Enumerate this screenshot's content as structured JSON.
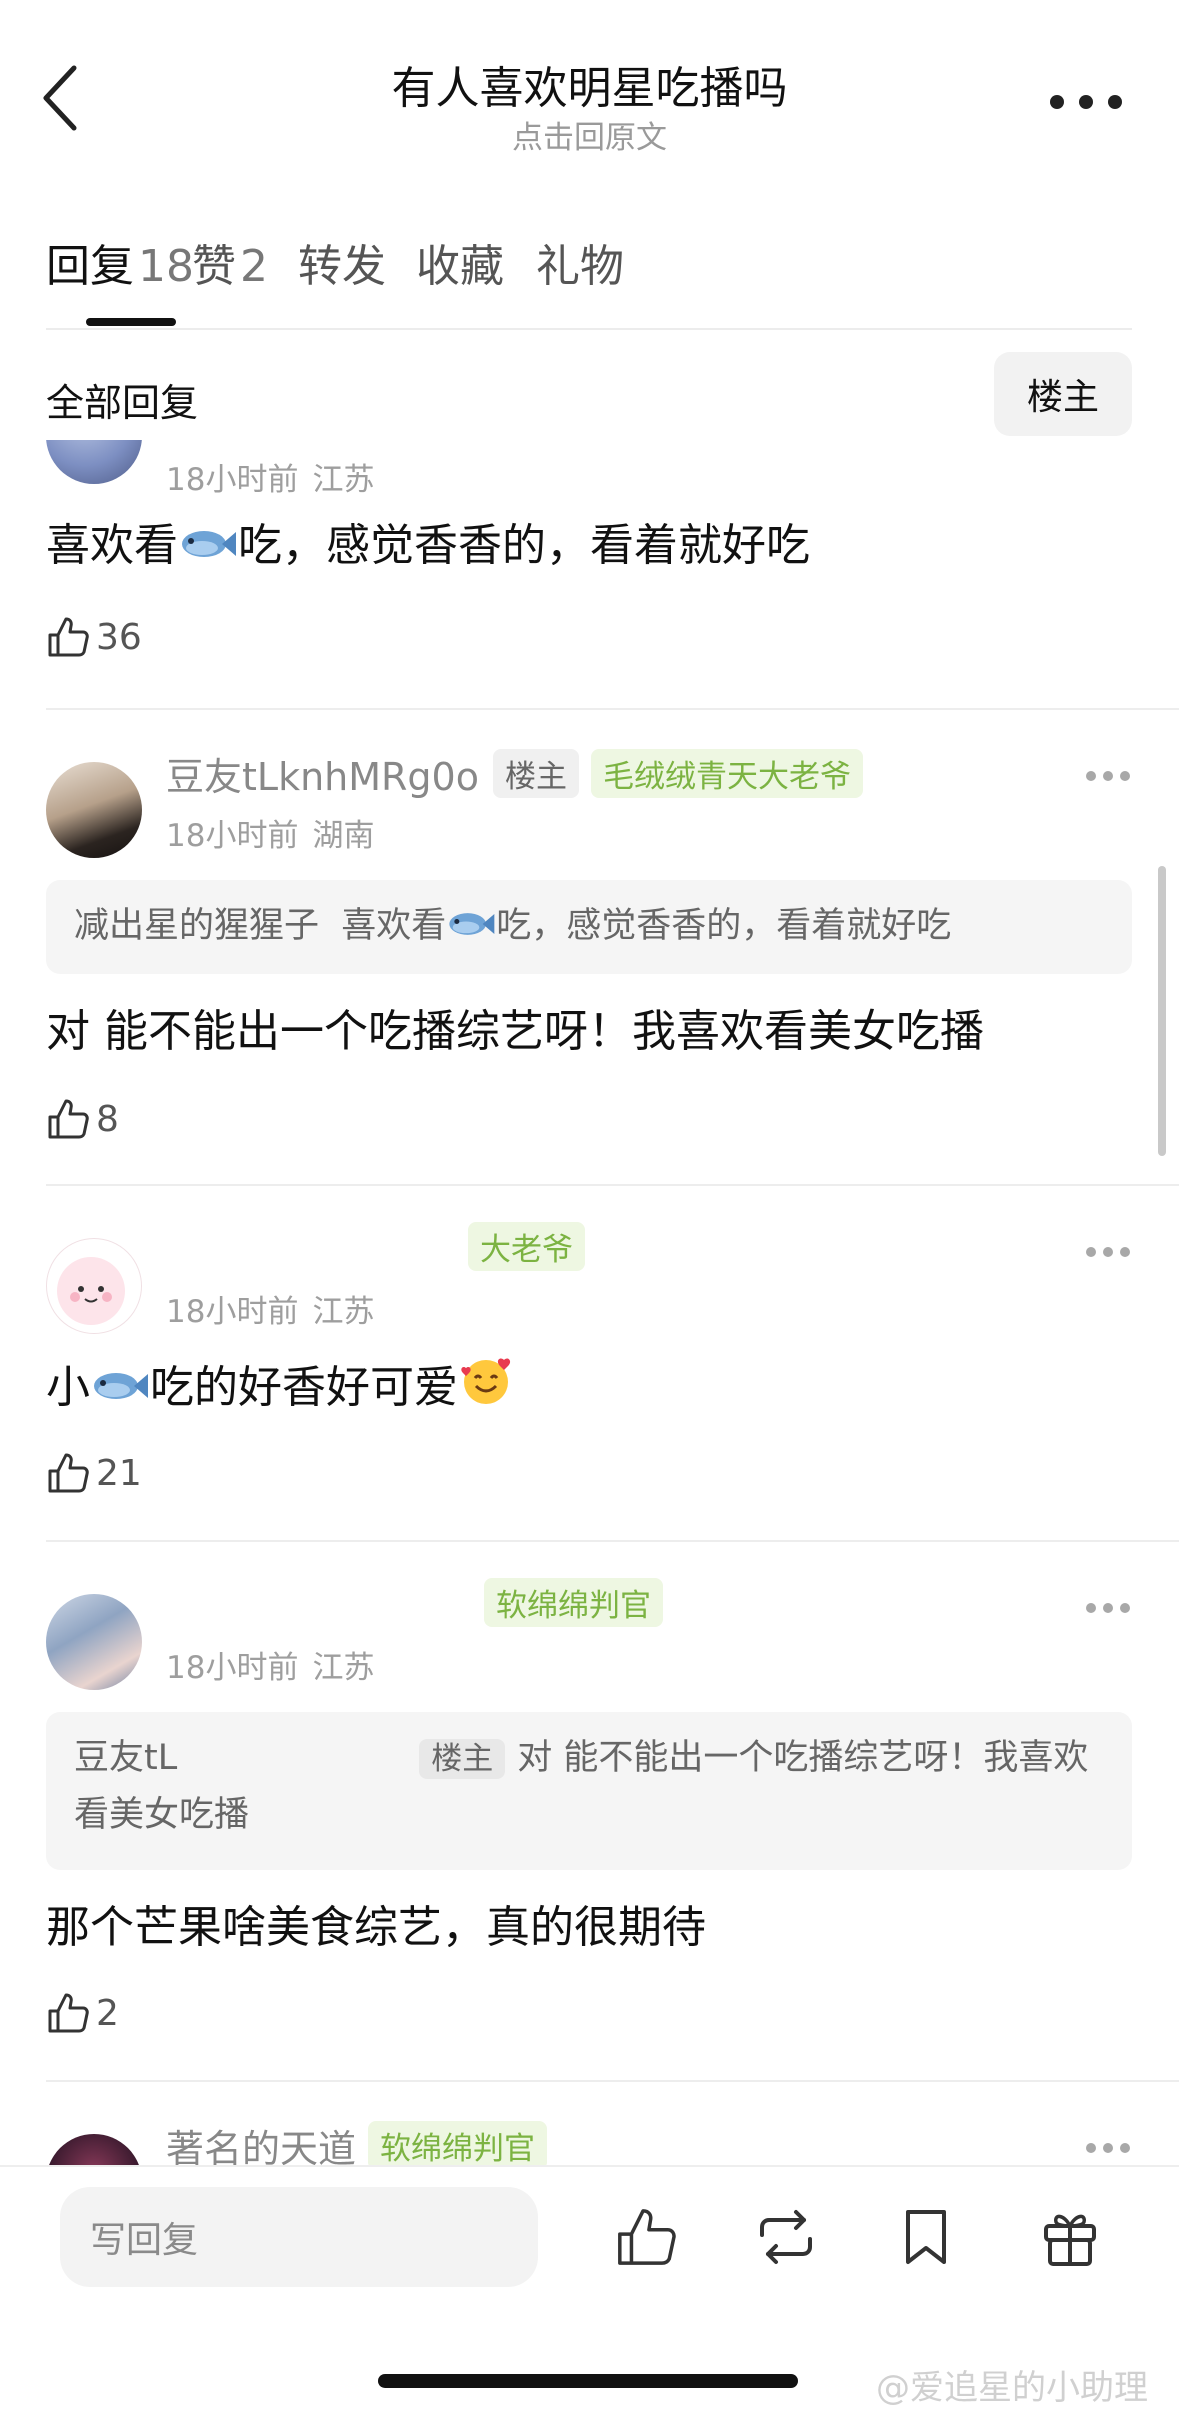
{
  "header": {
    "title": "有人喜欢明星吃播吗",
    "subtitle": "点击回原文"
  },
  "tabs": [
    {
      "label": "回复",
      "count": "18",
      "active": true
    },
    {
      "label": "赞",
      "count": "2",
      "active": false
    },
    {
      "label": "转发",
      "count": "",
      "active": false
    },
    {
      "label": "收藏",
      "count": "",
      "active": false
    },
    {
      "label": "礼物",
      "count": "",
      "active": false
    }
  ],
  "filter": {
    "all_label": "全部回复",
    "op_label": "楼主"
  },
  "comments": [
    {
      "time": "18小时前",
      "location": "江苏",
      "text_parts": [
        "喜欢看",
        "吃，感觉香香的，看着就好吃"
      ],
      "likes": "36"
    },
    {
      "username": "豆友tLknhMRg0o",
      "op_tag": "楼主",
      "badge": "毛绒绒青天大老爷",
      "time": "18小时前",
      "location": "湖南",
      "quote_user": "减出星的猩猩子",
      "quote_parts": [
        "喜欢看",
        "吃，感觉香香的，看着就好吃"
      ],
      "text": "对 能不能出一个吃播综艺呀！我喜欢看美女吃播",
      "likes": "8"
    },
    {
      "badge": "大老爷",
      "time": "18小时前",
      "location": "江苏",
      "text_parts": [
        "小",
        "吃的好香好可爱"
      ],
      "likes": "21"
    },
    {
      "badge": "软绵绵判官",
      "time": "18小时前",
      "location": "江苏",
      "quote_user": "豆友tL",
      "quote_tag": "楼主",
      "quote_text": "对 能不能出一个吃播综艺呀！我喜欢看美女吃播",
      "text": "那个芒果啥美食综艺，真的很期待",
      "likes": "2"
    },
    {
      "username": "著名的天道",
      "badge": "软绵绵判官"
    }
  ],
  "bottom_bar": {
    "reply_placeholder": "写回复"
  },
  "watermark": "@爱追星的小助理",
  "icons": [
    "back-arrow-icon",
    "more-icon",
    "thumb-up-icon",
    "fish-emoji-icon",
    "smiling-hearts-emoji-icon",
    "repost-icon",
    "bookmark-icon",
    "gift-icon"
  ]
}
